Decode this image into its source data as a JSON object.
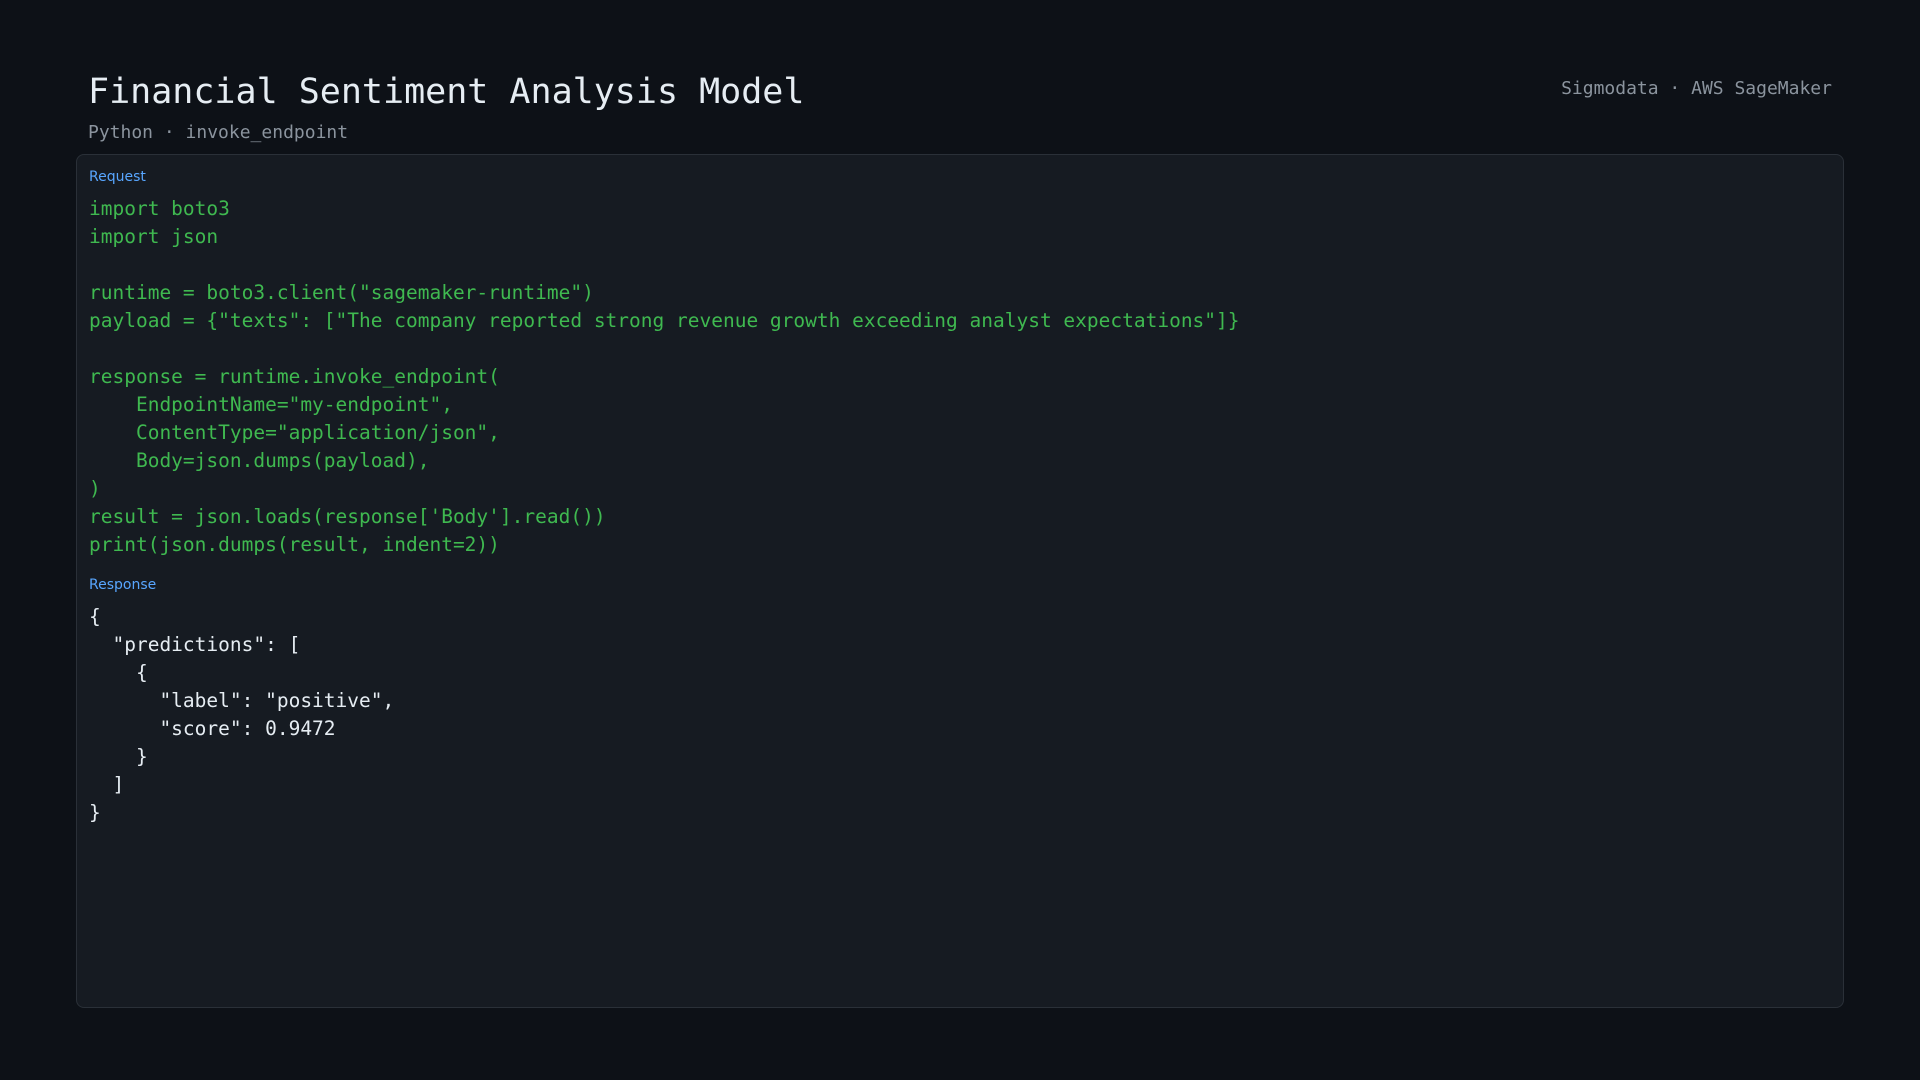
{
  "header": {
    "title": "Financial Sentiment Analysis Model",
    "subtitle": "Python · invoke_endpoint",
    "brand": "Sigmodata · AWS SageMaker"
  },
  "request": {
    "label": "Request",
    "code": "import boto3\nimport json\n\nruntime = boto3.client(\"sagemaker-runtime\")\npayload = {\"texts\": [\"The company reported strong revenue growth exceeding analyst expectations\"]}\n\nresponse = runtime.invoke_endpoint(\n    EndpointName=\"my-endpoint\",\n    ContentType=\"application/json\",\n    Body=json.dumps(payload),\n)\nresult = json.loads(response['Body'].read())\nprint(json.dumps(result, indent=2))"
  },
  "response": {
    "label": "Response",
    "code": "{\n  \"predictions\": [\n    {\n      \"label\": \"positive\",\n      \"score\": 0.9472\n    }\n  ]\n}"
  },
  "colors": {
    "background": "#0d1117",
    "panel": "#161b22",
    "code_request": "#3fb950",
    "code_response": "#e6edf3",
    "label_accent": "#58a6ff",
    "muted": "#8b949e"
  }
}
